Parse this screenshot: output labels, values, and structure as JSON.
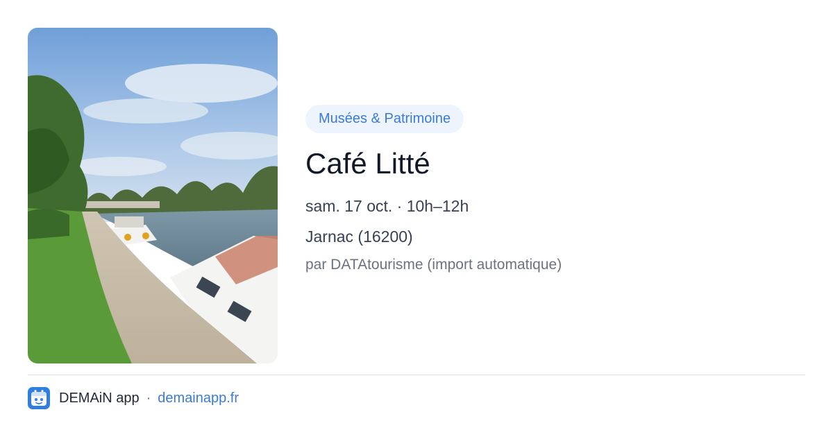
{
  "event": {
    "category": "Musées & Patrimoine",
    "title": "Café Litté",
    "datetime": "sam. 17 oct. · 10h–12h",
    "location": "Jarnac (16200)",
    "source": "par DATAtourisme (import automatique)"
  },
  "image": {
    "icon": "riverside-canal-photo"
  },
  "footer": {
    "app_name": "DEMAiN app",
    "separator": "·",
    "domain": "demainapp.fr",
    "icon": "demain-app-logo-icon"
  },
  "colors": {
    "accent": "#3a7bd5",
    "badge_bg": "#eef4fd",
    "app_icon_bg": "#2f7fe0"
  }
}
